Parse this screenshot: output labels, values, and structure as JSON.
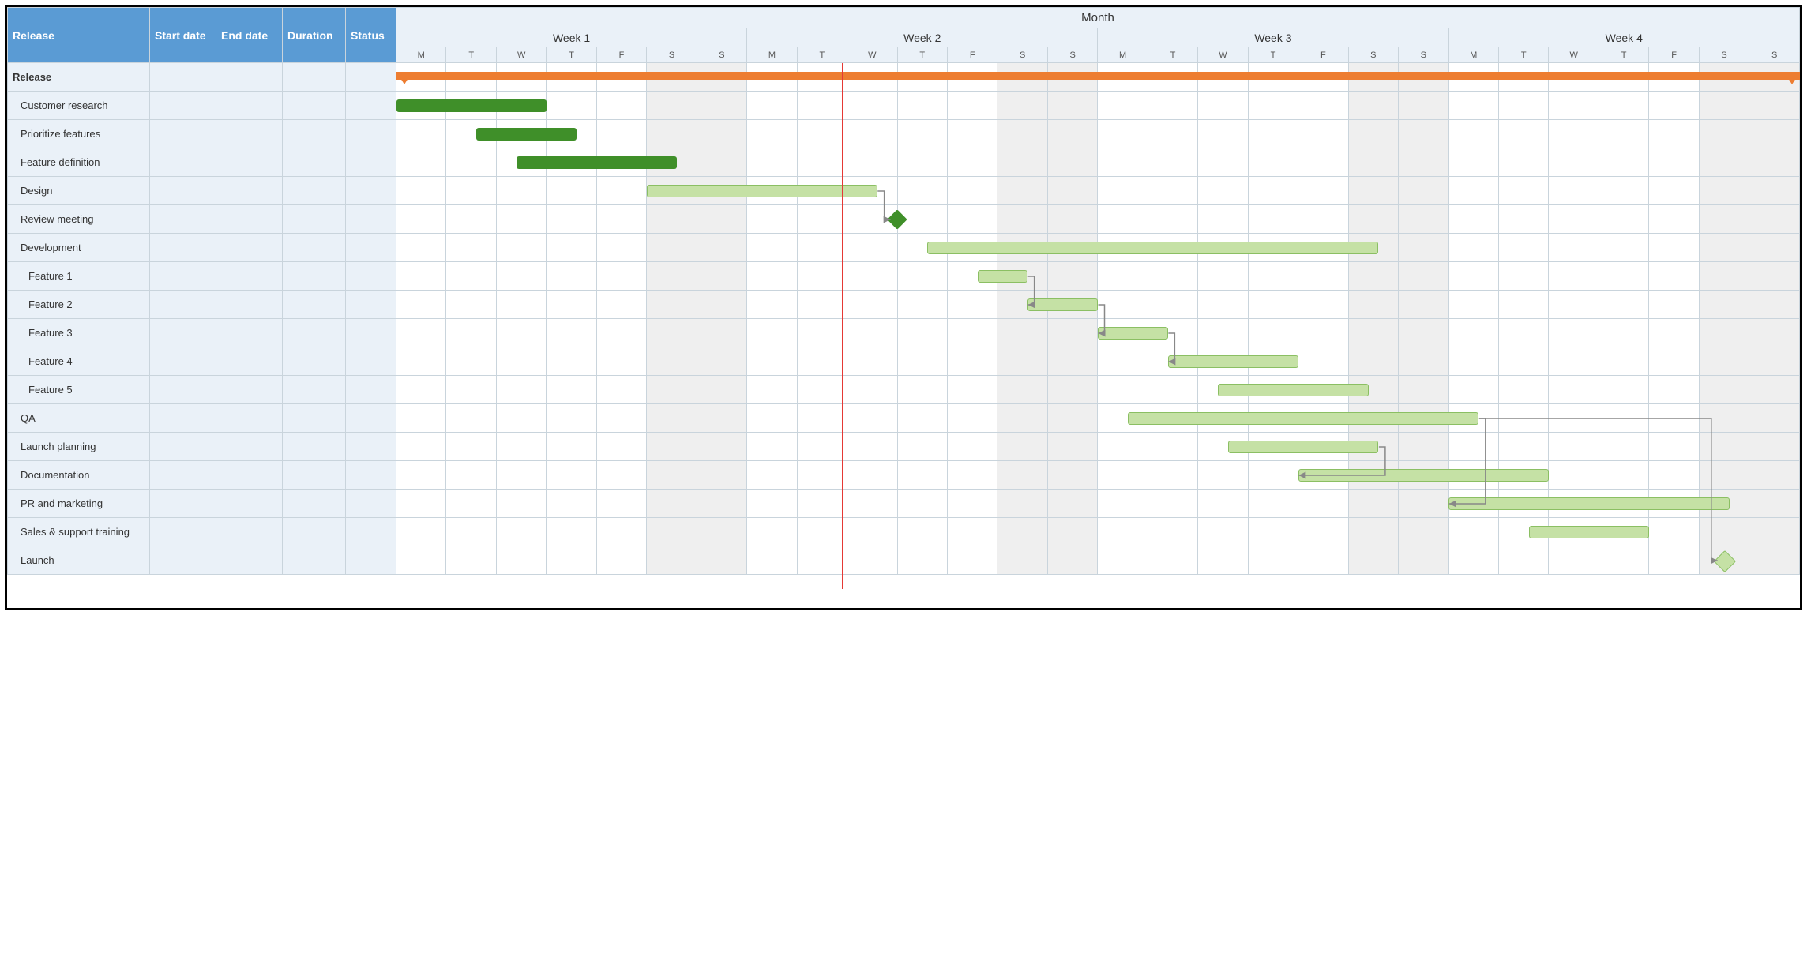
{
  "columns": {
    "name": "Release",
    "start": "Start date",
    "end": "End date",
    "duration": "Duration",
    "status": "Status"
  },
  "timeline": {
    "title": "Month",
    "weeks": [
      "Week 1",
      "Week 2",
      "Week 3",
      "Week 4"
    ],
    "days": [
      "M",
      "T",
      "W",
      "T",
      "F",
      "S",
      "S"
    ],
    "weekend_indices": [
      5,
      6
    ],
    "today_day_index": 8.9
  },
  "chart_data": {
    "type": "gantt",
    "x_unit": "day",
    "x_range": [
      0,
      28
    ],
    "columns": [
      "name",
      "start_day",
      "end_day",
      "kind",
      "state",
      "indent"
    ],
    "tasks": [
      {
        "name": "Release",
        "start_day": 0,
        "end_day": 28,
        "kind": "summary",
        "state": "",
        "indent": 0
      },
      {
        "name": "Customer research",
        "start_day": 0,
        "end_day": 3,
        "kind": "task",
        "state": "done",
        "indent": 1
      },
      {
        "name": "Prioritize features",
        "start_day": 1.6,
        "end_day": 3.6,
        "kind": "task",
        "state": "done",
        "indent": 1
      },
      {
        "name": "Feature definition",
        "start_day": 2.4,
        "end_day": 5.6,
        "kind": "task",
        "state": "done",
        "indent": 1
      },
      {
        "name": "Design",
        "start_day": 5,
        "end_day": 9.6,
        "kind": "task",
        "state": "todo",
        "indent": 1
      },
      {
        "name": "Review meeting",
        "start_day": 10,
        "end_day": 10,
        "kind": "milestone",
        "state": "done",
        "indent": 1
      },
      {
        "name": "Development",
        "start_day": 10.6,
        "end_day": 19.6,
        "kind": "task",
        "state": "todo",
        "indent": 1
      },
      {
        "name": "Feature 1",
        "start_day": 11.6,
        "end_day": 12.6,
        "kind": "task",
        "state": "todo",
        "indent": 2
      },
      {
        "name": "Feature 2",
        "start_day": 12.6,
        "end_day": 14,
        "kind": "task",
        "state": "todo",
        "indent": 2
      },
      {
        "name": "Feature 3",
        "start_day": 14,
        "end_day": 15.4,
        "kind": "task",
        "state": "todo",
        "indent": 2
      },
      {
        "name": "Feature 4",
        "start_day": 15.4,
        "end_day": 18,
        "kind": "task",
        "state": "todo",
        "indent": 2
      },
      {
        "name": "Feature 5",
        "start_day": 16.4,
        "end_day": 19.4,
        "kind": "task",
        "state": "todo",
        "indent": 2
      },
      {
        "name": "QA",
        "start_day": 14.6,
        "end_day": 21.6,
        "kind": "task",
        "state": "todo",
        "indent": 1
      },
      {
        "name": "Launch planning",
        "start_day": 16.6,
        "end_day": 19.6,
        "kind": "task",
        "state": "todo",
        "indent": 1
      },
      {
        "name": "Documentation",
        "start_day": 18,
        "end_day": 23,
        "kind": "task",
        "state": "todo",
        "indent": 1
      },
      {
        "name": "PR and  marketing",
        "start_day": 21,
        "end_day": 26.6,
        "kind": "task",
        "state": "todo",
        "indent": 1
      },
      {
        "name": "Sales & support training",
        "start_day": 22.6,
        "end_day": 25,
        "kind": "task",
        "state": "todo",
        "indent": 1
      },
      {
        "name": "Launch",
        "start_day": 26.5,
        "end_day": 26.5,
        "kind": "milestone",
        "state": "todo",
        "indent": 1
      }
    ],
    "dependencies": [
      {
        "from": "Design",
        "to": "Review meeting"
      },
      {
        "from": "Feature 1",
        "to": "Feature 2"
      },
      {
        "from": "Feature 2",
        "to": "Feature 3"
      },
      {
        "from": "Feature 3",
        "to": "Feature 4"
      },
      {
        "from": "QA",
        "to": "PR and  marketing"
      },
      {
        "from": "Launch planning",
        "to": "Documentation"
      },
      {
        "from": "QA",
        "to": "Launch"
      }
    ]
  }
}
